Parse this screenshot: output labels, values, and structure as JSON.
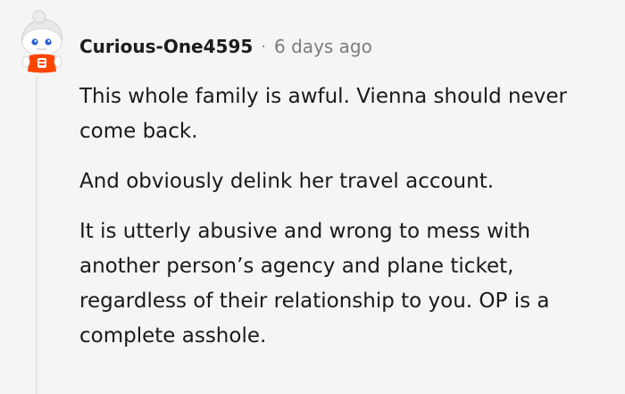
{
  "comment": {
    "author": "Curious-One4595",
    "separator": "·",
    "timestamp": "6 days ago",
    "avatar_icon": "snoo-avatar-icon",
    "paragraphs": [
      "This whole family is awful. Vienna should never come back.",
      "And obviously delink her travel account.",
      "It is utterly abusive and wrong to mess with another person’s agency and plane ticket, regardless of their relationship to you. OP is a complete asshole."
    ]
  },
  "colors": {
    "background": "#f5f5f5",
    "text": "#1a1a1a",
    "muted": "#7c7c7c",
    "thread_line": "#e4e4e4",
    "avatar_accent": "#ff4500"
  }
}
